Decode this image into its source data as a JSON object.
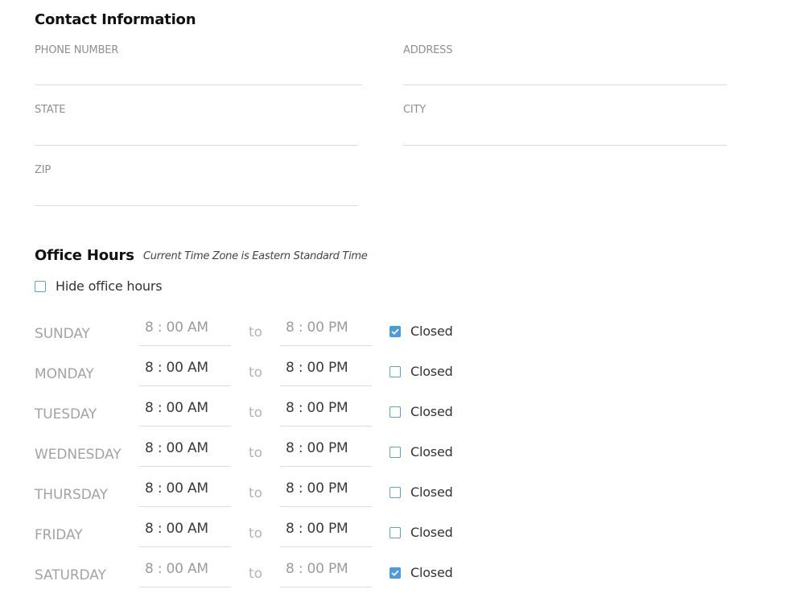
{
  "contact": {
    "title": "Contact Information",
    "fields": {
      "phone": {
        "label": "PHONE NUMBER",
        "value": ""
      },
      "address": {
        "label": "ADDRESS",
        "value": ""
      },
      "state": {
        "label": "STATE",
        "value": ""
      },
      "city": {
        "label": "CITY",
        "value": ""
      },
      "zip": {
        "label": "ZIP",
        "value": ""
      }
    }
  },
  "office_hours": {
    "title": "Office Hours",
    "timezone_note": "Current Time Zone is Eastern Standard Time",
    "hide_label": "Hide office hours",
    "hide_checked": false,
    "to_label": "to",
    "closed_label": "Closed",
    "days": [
      {
        "name": "SUNDAY",
        "open": "8 : 00 AM",
        "close": "8 : 00 PM",
        "closed": true
      },
      {
        "name": "MONDAY",
        "open": "8 : 00 AM",
        "close": "8 : 00 PM",
        "closed": false
      },
      {
        "name": "TUESDAY",
        "open": "8 : 00 AM",
        "close": "8 : 00 PM",
        "closed": false
      },
      {
        "name": "WEDNESDAY",
        "open": "8 : 00 AM",
        "close": "8 : 00 PM",
        "closed": false
      },
      {
        "name": "THURSDAY",
        "open": "8 : 00 AM",
        "close": "8 : 00 PM",
        "closed": false
      },
      {
        "name": "FRIDAY",
        "open": "8 : 00 AM",
        "close": "8 : 00 PM",
        "closed": false
      },
      {
        "name": "SATURDAY",
        "open": "8 : 00 AM",
        "close": "8 : 00 PM",
        "closed": true
      }
    ]
  },
  "colors": {
    "checkbox_accent": "#4a9be0",
    "label_gray": "#8f8f8f",
    "divider": "#dcdcdc"
  }
}
